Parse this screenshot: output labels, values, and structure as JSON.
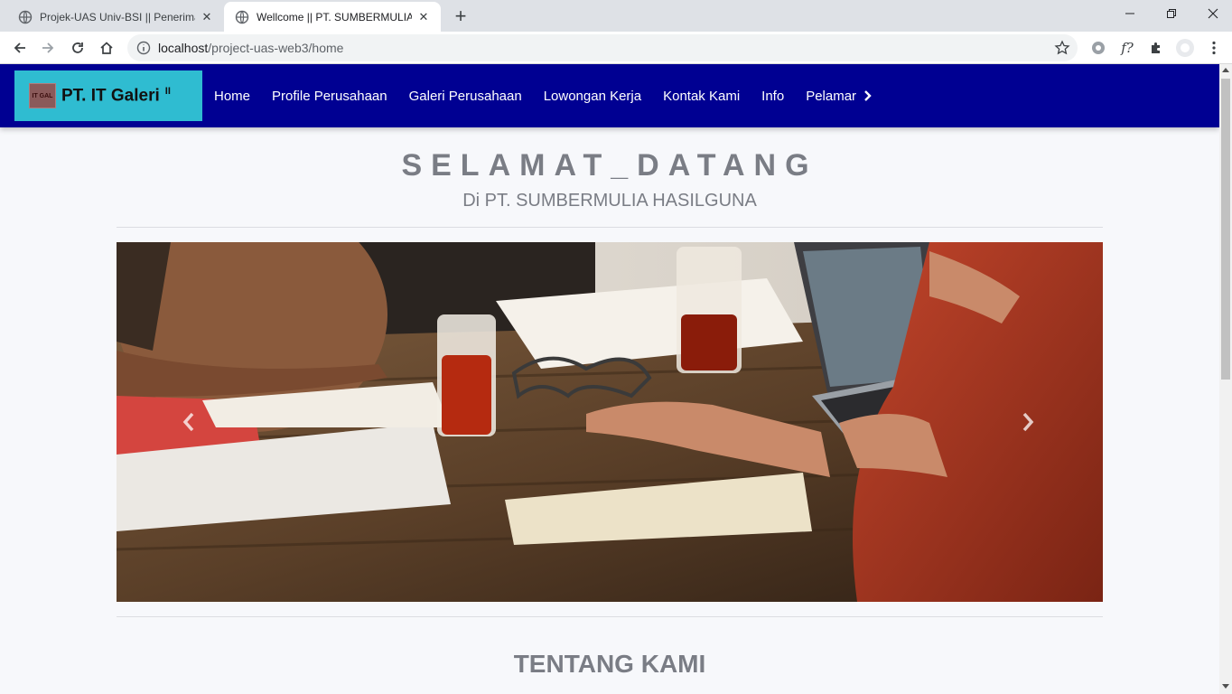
{
  "browser": {
    "tabs": [
      {
        "title": "Projek-UAS Univ-BSI || Penerimaan",
        "active": false
      },
      {
        "title": "Wellcome || PT. SUMBERMULIA HASILGUNA",
        "active": true
      }
    ],
    "new_tab_label": "+",
    "url_host": "localhost",
    "url_path": "/project-uas-web3/home",
    "window_controls": {
      "minimize": "—",
      "restore": "❐",
      "close": "✕"
    },
    "extensions": [
      "settings-gear-icon",
      "formula-icon",
      "puzzle-icon",
      "profile-icon",
      "menu-dots-icon"
    ],
    "formula_ext_label": "f?"
  },
  "site": {
    "brand": {
      "name": "PT. IT Galeri",
      "sup": "II",
      "logo_text": "IT GAL"
    },
    "menu": [
      {
        "label": "Home"
      },
      {
        "label": "Profile Perusahaan"
      },
      {
        "label": "Galeri Perusahaan"
      },
      {
        "label": "Lowongan Kerja"
      },
      {
        "label": "Kontak Kami"
      },
      {
        "label": "Info"
      },
      {
        "label": "Pelamar"
      }
    ],
    "hero": {
      "title": "SELAMAT_DATANG",
      "subtitle": "Di PT. SUMBERMULIA HASILGUNA"
    },
    "carousel": {
      "prev_icon": "chevron-left-icon",
      "next_icon": "chevron-right-icon"
    },
    "about_title": "TENTANG KAMI"
  },
  "colors": {
    "navbar": "#000092",
    "brand_bg": "#2fbcd1",
    "heading_text": "#7a7d85",
    "page_bg": "#f7f8fb"
  }
}
